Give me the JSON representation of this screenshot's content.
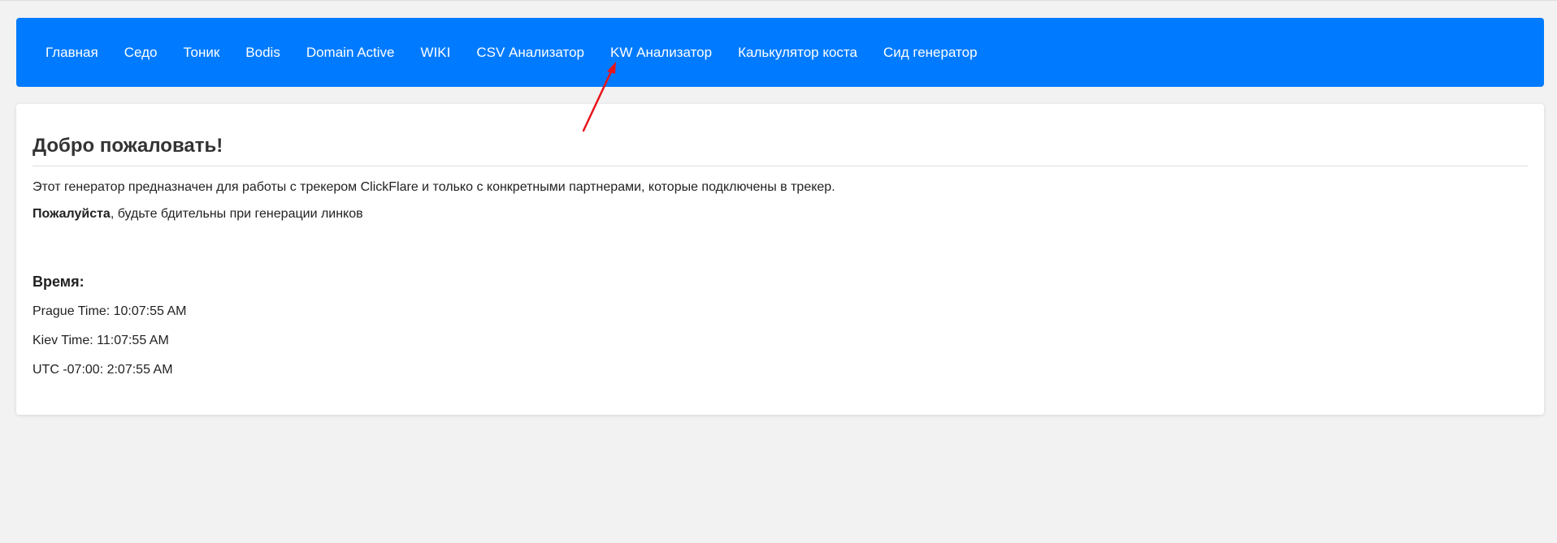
{
  "nav": {
    "items": [
      {
        "label": "Главная"
      },
      {
        "label": "Седо"
      },
      {
        "label": "Тоник"
      },
      {
        "label": "Bodis"
      },
      {
        "label": "Domain Active"
      },
      {
        "label": "WIKI"
      },
      {
        "label": "CSV Анализатор"
      },
      {
        "label": "KW Анализатор"
      },
      {
        "label": "Калькулятор коста"
      },
      {
        "label": "Сид генератор"
      }
    ]
  },
  "main": {
    "title": "Добро пожаловать!",
    "description": "Этот генератор предназначен для работы с трекером ClickFlare и только с конкретными партнерами, которые подключены в трекер.",
    "warning_bold": "Пожалуйста",
    "warning_rest": ", будьте бдительны при генерации линков",
    "time_heading": "Время:",
    "times": [
      {
        "text": "Prague Time: 10:07:55 AM"
      },
      {
        "text": "Kiev Time: 11:07:55 AM"
      },
      {
        "text": "UTC -07:00: 2:07:55 AM"
      }
    ]
  },
  "colors": {
    "navbar": "#007bff",
    "background": "#f2f2f2",
    "annotation_arrow": "#e8141b"
  }
}
